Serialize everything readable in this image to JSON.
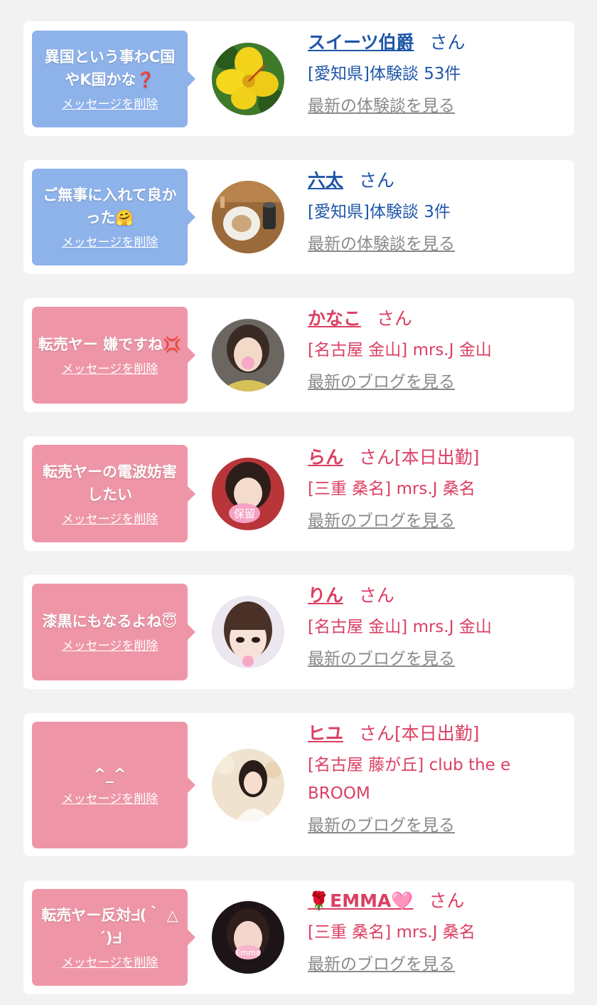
{
  "delete_label": "メッセージを削除",
  "san_label": "さん",
  "colors": {
    "blue_bubble": "#8eb2ea",
    "pink_bubble": "#ee96a7",
    "blue_text": "#1e56a8",
    "pink_text": "#db3f63",
    "link_gray": "#8a8a8a"
  },
  "cards": [
    {
      "message": "異国という事わC国やK国かな❓",
      "name": "スイーツ伯爵",
      "status": "",
      "area": "[愛知県]体験談 53件",
      "latest": "最新の体験談を見る",
      "avatar_icon": "yellow-flower-photo"
    },
    {
      "message": "ご無事に入れて良かった🤗",
      "name": "六太",
      "status": "",
      "area": "[愛知県]体験談 3件",
      "latest": "最新の体験談を見る",
      "avatar_icon": "dinner-plate-photo"
    },
    {
      "message": "転売ヤー 嫌ですね💢",
      "name": "かなこ",
      "status": "",
      "area": "[名古屋 金山] mrs.J 金山",
      "latest": "最新のブログを見る",
      "avatar_icon": "woman-portrait-photo"
    },
    {
      "message": "転売ヤーの電波妨害したい",
      "name": "らん",
      "status": "[本日出勤]",
      "area": "[三重 桑名] mrs.J 桑名",
      "latest": "最新のブログを見る",
      "avatar_icon": "woman-portrait-photo",
      "avatar_stamp": "保留"
    },
    {
      "message": "漆黒にもなるよね😇",
      "name": "りん",
      "status": "",
      "area": "[名古屋 金山] mrs.J 金山",
      "latest": "最新のブログを見る",
      "avatar_icon": "woman-portrait-photo"
    },
    {
      "message": "^_^",
      "name": "ヒユ",
      "status": "[本日出勤]",
      "area": "[名古屋 藤が丘] club the e BROOM",
      "latest": "最新のブログを見る",
      "avatar_icon": "woman-portrait-photo"
    },
    {
      "message": "転売ヤー反対ᖵ(｀ △´)ᖵ",
      "name": "🌹EMMA🩷",
      "status": "",
      "area": "[三重 桑名] mrs.J 桑名",
      "latest": "最新のブログを見る",
      "avatar_icon": "woman-portrait-photo",
      "avatar_stamp": "Emma"
    }
  ]
}
